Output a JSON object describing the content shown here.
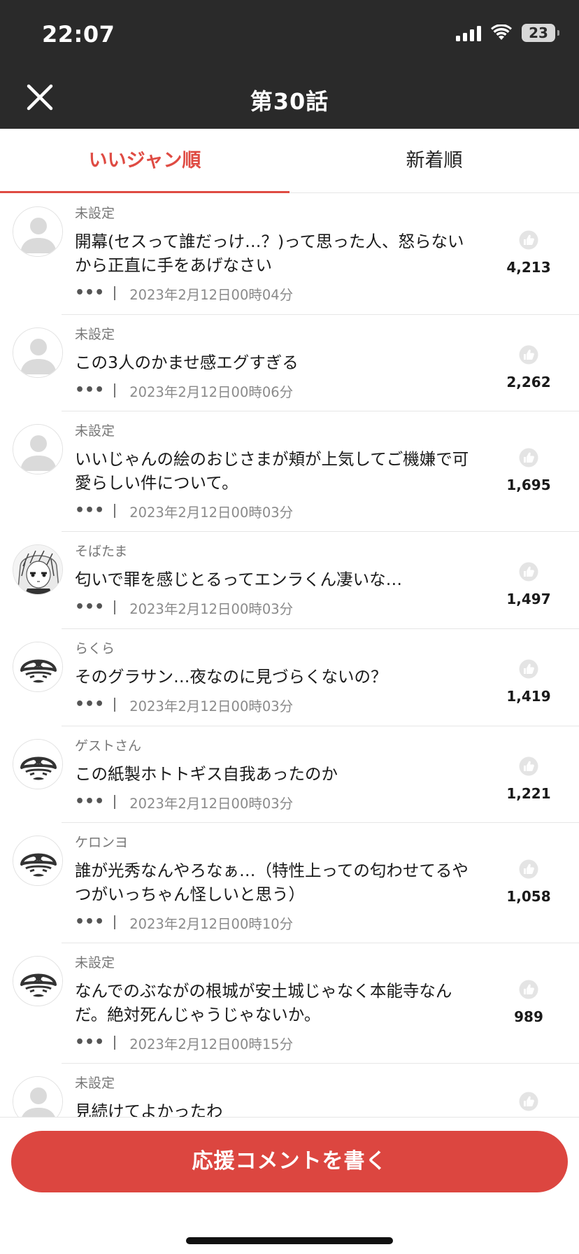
{
  "status_bar": {
    "time": "22:07",
    "battery": "23"
  },
  "header": {
    "title": "第30話",
    "close_icon": "close-icon"
  },
  "tabs": [
    {
      "label": "いいジャン順",
      "active": true
    },
    {
      "label": "新着順",
      "active": false
    }
  ],
  "colors": {
    "accent": "#df4b43",
    "header_bg": "#2a2a2a",
    "cta": "#dc4640"
  },
  "comments": [
    {
      "user": "未設定",
      "text": "開幕(セスって誰だっけ…？)って思った人、怒らないから正直に手をあげなさい",
      "date": "2023年2月12日00時04分",
      "likes": "4,213",
      "avatar": "default"
    },
    {
      "user": "未設定",
      "text": "この3人のかませ感エグすぎる",
      "date": "2023年2月12日00時06分",
      "likes": "2,262",
      "avatar": "default"
    },
    {
      "user": "未設定",
      "text": "いいじゃんの絵のおじさまが頬が上気してご機嫌で可愛らしい件について。",
      "date": "2023年2月12日00時03分",
      "likes": "1,695",
      "avatar": "default"
    },
    {
      "user": "そばたま",
      "text": "匂いで罪を感じとるってエンラくん凄いな…",
      "date": "2023年2月12日00時03分",
      "likes": "1,497",
      "avatar": "manga"
    },
    {
      "user": "らくら",
      "text": "そのグラサン…夜なのに見づらくないの？",
      "date": "2023年2月12日00時03分",
      "likes": "1,419",
      "avatar": "pirate"
    },
    {
      "user": "ゲストさん",
      "text": "この紙製ホトトギス自我あったのか",
      "date": "2023年2月12日00時03分",
      "likes": "1,221",
      "avatar": "pirate"
    },
    {
      "user": "ケロンヨ",
      "text": "誰が光秀なんやろなぁ…（特性上っての匂わせてるやつがいっちゃん怪しいと思う）",
      "date": "2023年2月12日00時10分",
      "likes": "1,058",
      "avatar": "pirate"
    },
    {
      "user": "未設定",
      "text": "なんでのぶながの根城が安土城じゃなく本能寺なんだ。絶対死んじゃうじゃないか。",
      "date": "2023年2月12日00時15分",
      "likes": "989",
      "avatar": "pirate"
    },
    {
      "user": "未設定",
      "text": "見続けてよかったわ",
      "date": "",
      "likes": "",
      "avatar": "default"
    }
  ],
  "more_glyph": "•••",
  "cta_label": "応援コメントを書く"
}
